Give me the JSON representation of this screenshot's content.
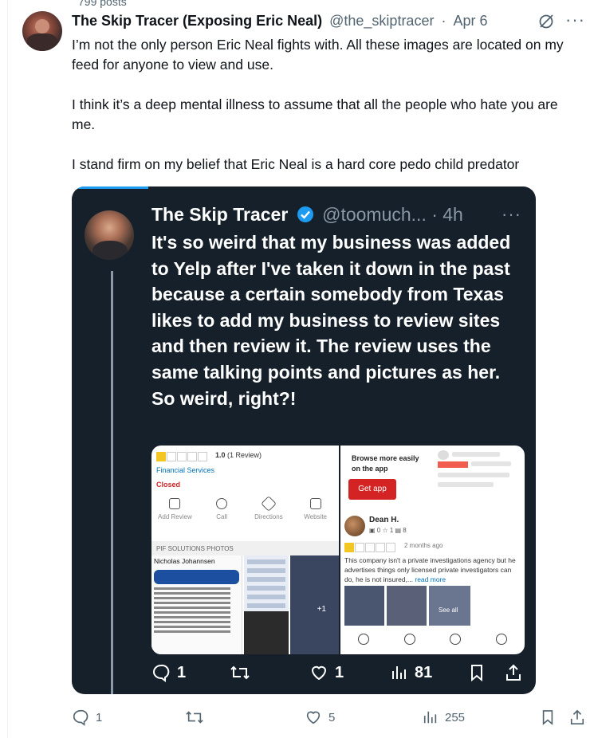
{
  "profile": {
    "post_count": "799 posts"
  },
  "post": {
    "display_name": "The Skip Tracer (Exposing Eric Neal)",
    "handle": "@the_skiptracer",
    "separator": "·",
    "date": "Apr 6",
    "text": "I’m not the only person Eric Neal fights with. All these images are located on my feed for anyone to view and use.\n\nI think it’s a deep mental illness to assume that all the people who hate you are me.\n\nI stand firm on my belief that Eric Neal is a hard core pedo child predator",
    "stats": {
      "replies": "1",
      "reposts": "",
      "likes": "5",
      "views": "255"
    }
  },
  "embedded": {
    "display_name": "The Skip Tracer",
    "handle": "@toomuch...",
    "time": "· 4h",
    "text": "It's so weird that my business was added to Yelp after I've taken it down in the past because a certain somebody from Texas likes to add my business to review sites and then review it. The review uses the same talking points and pictures as her. So weird, right?!",
    "stats": {
      "replies": "1",
      "likes": "1",
      "views": "81"
    },
    "yelp": {
      "rating_value": "1.0",
      "rating_count": "(1 Review)",
      "category": "Financial Services",
      "status": "Closed",
      "actions": [
        "Add Review",
        "Call",
        "Directions",
        "Website"
      ],
      "photos_header": "PIF SOLUTIONS PHOTOS",
      "photo_caption": "Nicholas Johannsen",
      "photo_more": "+1",
      "browse_text": "Browse more easily on the app",
      "get_app": "Get app",
      "reviewer_name": "Dean H.",
      "reviewer_stats": "▣ 0   ☆ 1   ▤ 8",
      "review_date": "2 months ago",
      "review_text": "This company isn't a private investigations agency but he advertises things only licensed private investigators can do, he is not insured,...",
      "read_more": "read more",
      "see_all": "See all"
    }
  },
  "colors": {
    "embed_bg": "#15202b",
    "accent": "#1d9bf0",
    "yelp_red": "#d32323",
    "muted": "#536471"
  }
}
